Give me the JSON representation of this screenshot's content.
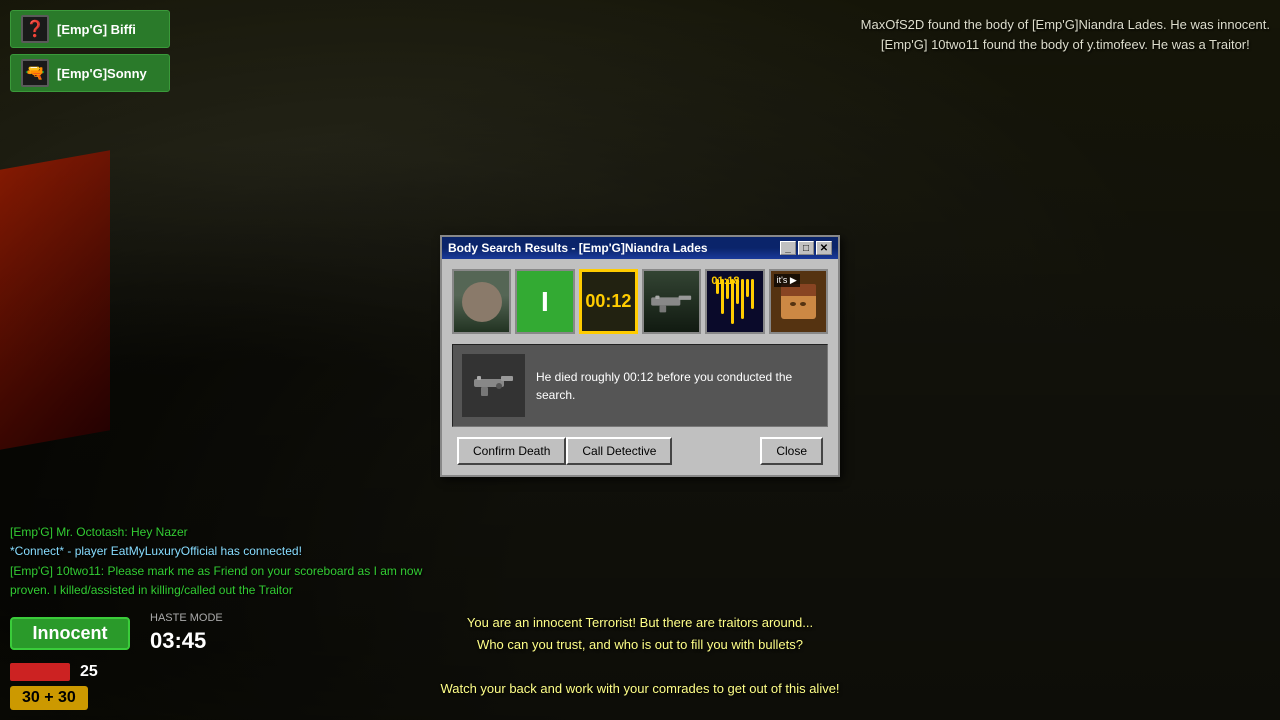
{
  "game": {
    "bg_color": "#2a3020"
  },
  "top_messages": {
    "line1": "MaxOfS2D found the body of [Emp'G]Niandra Lades. He was innocent.",
    "line2": "[Emp'G] 10two11 found the body of y.timofeev. He was a Traitor!"
  },
  "player_list": {
    "items": [
      {
        "id": "biffi",
        "name": "[Emp'G] Biffi",
        "icon": "❓"
      },
      {
        "id": "sonny",
        "name": "[Emp'G]Sonny",
        "icon": "🔫"
      }
    ]
  },
  "chat": {
    "messages": [
      {
        "type": "player",
        "text": "[Emp'G] Mr. Octotash: Hey Nazer"
      },
      {
        "type": "system",
        "text": "*Connect* - player EatMyLuxuryOfficial has connected!"
      },
      {
        "type": "player",
        "text": "[Emp'G] 10two11: Please mark me as Friend on your scoreboard as I am now proven. I killed/assisted in killing/called out the Traitor"
      }
    ]
  },
  "hud": {
    "role": "Innocent",
    "haste_label": "HASTE MODE",
    "timer": "03:45",
    "health": 25,
    "ammo": "30 + 30"
  },
  "bottom_msg": {
    "line1": "You are an innocent Terrorist! But there are traitors around...",
    "line2": "Who can you trust, and who is out to fill you with bullets?",
    "line3": "",
    "line4": "Watch your back and work with your comrades to get out of this alive!"
  },
  "modal": {
    "title": "Body Search Results - [Emp'G]Niandra Lades",
    "death_time": "00:12",
    "wave_time": "01:18",
    "death_info": "He died roughly 00:12 before you conducted the search.",
    "buttons": {
      "confirm": "Confirm Death",
      "detective": "Call Detective",
      "close": "Close"
    },
    "evidence_items": [
      {
        "type": "face",
        "label": "face"
      },
      {
        "type": "green-i",
        "label": "innocent"
      },
      {
        "type": "timer",
        "value": "00:12",
        "label": "death time",
        "selected": true
      },
      {
        "type": "gun",
        "label": "weapon"
      },
      {
        "type": "wave",
        "value": "01:18",
        "label": "wave"
      },
      {
        "type": "char",
        "label": "character",
        "badge": "it's"
      }
    ]
  }
}
